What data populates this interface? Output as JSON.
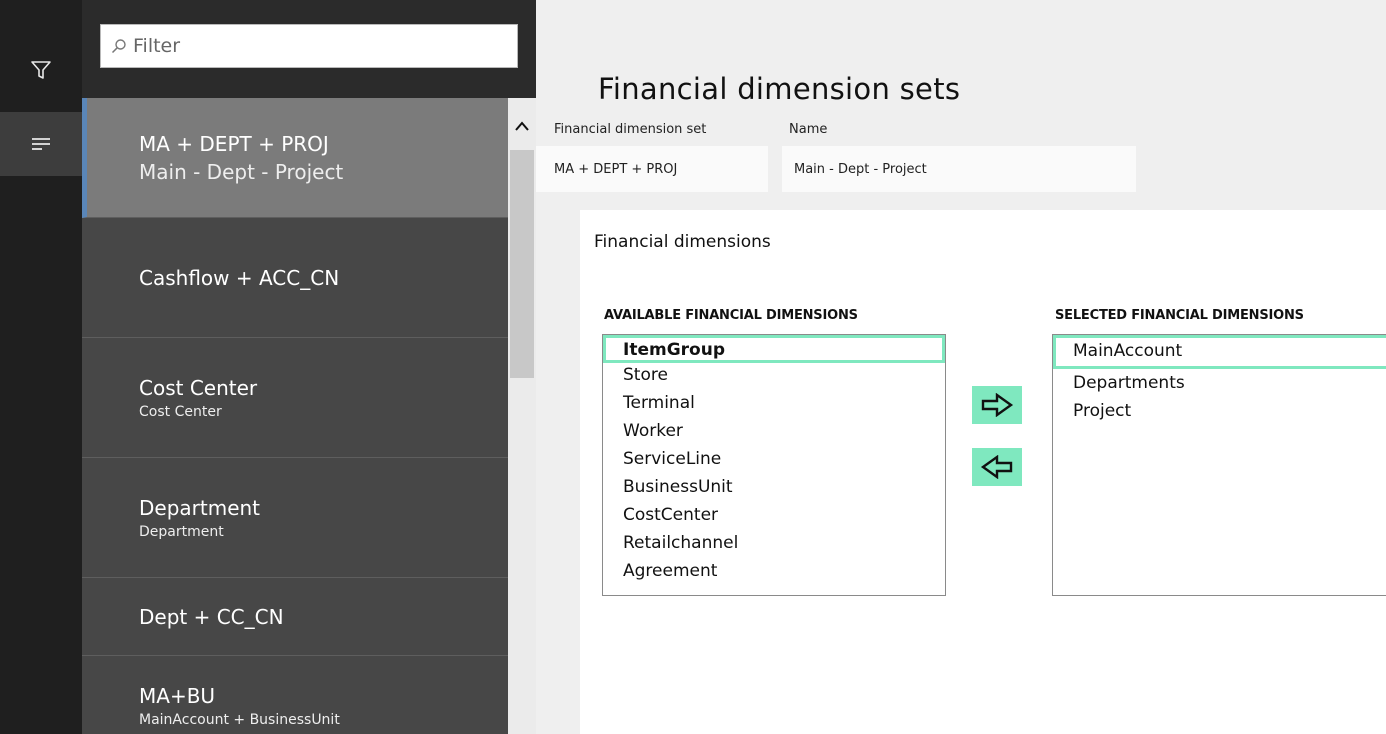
{
  "rail": {
    "filter_icon": "funnel-icon",
    "list_icon": "list-lines-icon"
  },
  "list": {
    "filter_placeholder": "Filter",
    "search_icon": "search-icon",
    "items": [
      {
        "line1": "MA + DEPT + PROJ",
        "line2": "Main - Dept - Project"
      },
      {
        "line1": "Cashflow + ACC_CN",
        "line2": ""
      },
      {
        "line1": "Cost Center",
        "line2": "Cost Center"
      },
      {
        "line1": "Department",
        "line2": "Department"
      },
      {
        "line1": "Dept + CC_CN",
        "line2": ""
      },
      {
        "line1": "MA+BU",
        "line2": "MainAccount + BusinessUnit"
      }
    ],
    "selected_index": 0
  },
  "detail": {
    "title": "Financial dimension sets",
    "fields": {
      "set_label": "Financial dimension set",
      "set_value": "MA + DEPT + PROJ",
      "name_label": "Name",
      "name_value": "Main - Dept - Project"
    },
    "panel": {
      "title": "Financial dimensions",
      "available_header": "AVAILABLE FINANCIAL DIMENSIONS",
      "selected_header": "SELECTED FINANCIAL DIMENSIONS",
      "available": [
        "ItemGroup",
        "Store",
        "Terminal",
        "Worker",
        "ServiceLine",
        "BusinessUnit",
        "CostCenter",
        "Retailchannel",
        "Agreement"
      ],
      "selected": [
        "MainAccount",
        "Departments",
        "Project"
      ],
      "add_icon": "arrow-right-icon",
      "remove_icon": "arrow-left-icon",
      "accent_color": "#7fe8bf"
    }
  }
}
